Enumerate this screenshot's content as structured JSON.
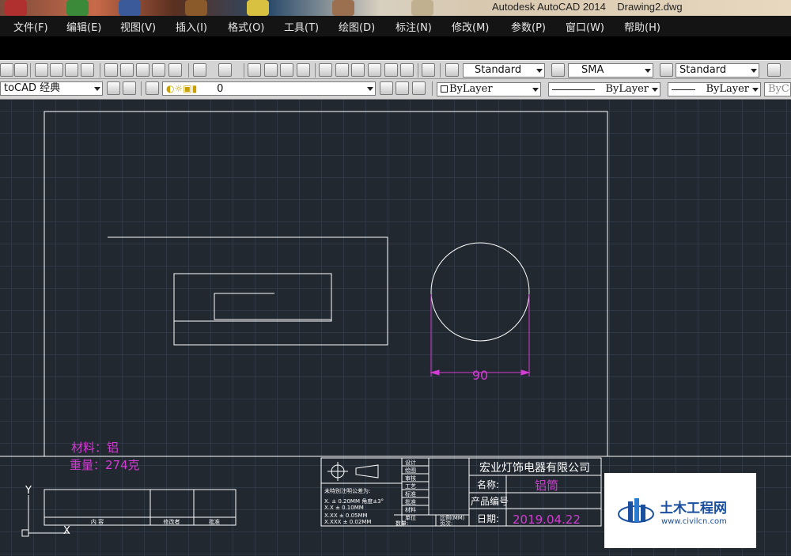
{
  "window": {
    "title": "Autodesk AutoCAD 2014    Drawing2.dwg"
  },
  "menu": {
    "items": [
      "文件(F)",
      "编辑(E)",
      "视图(V)",
      "插入(I)",
      "格式(O)",
      "工具(T)",
      "绘图(D)",
      "标注(N)",
      "修改(M)",
      "参数(P)",
      "窗口(W)",
      "帮助(H)"
    ]
  },
  "toolbar1": {
    "text_style": "Standard",
    "dim_style": "SMA",
    "table_style": "Standard"
  },
  "toolbar2": {
    "workspace": "toCAD 经典",
    "layer": "0",
    "color": "ByLayer",
    "linetype": "ByLayer",
    "lineweight": "ByLayer",
    "plotstyle": "ByCo"
  },
  "drawing": {
    "dimension_value": "90",
    "material_label": "材料：铝",
    "weight_label": "重量：274克",
    "ucs_x": "X",
    "ucs_y": "Y",
    "title_block": {
      "company": "宏业灯饰电器有限公司",
      "name_label": "名称:",
      "name_value": "铝筒",
      "product_no_label": "产品编号",
      "date_label": "日期:",
      "date_value": "2019.04.22",
      "role_labels": [
        "设计",
        "绘图",
        "审核",
        "工艺",
        "标准",
        "批准"
      ],
      "tolerance_title": "未特别注明公差为:",
      "tolerance_lines": [
        "X.       ± 0.20MM  角度±3°",
        "X.X      ± 0.10MM",
        "X.XX     ± 0.05MM",
        "X.XXX ± 0.02MM"
      ],
      "unit_label": "单位",
      "scale_label": "比例(MM)",
      "qty_label": "数量:",
      "page_label": "页次:",
      "material_cell": "材料"
    },
    "revision_block": {
      "col1": "内  容",
      "col2": "修改者",
      "col3": "批准"
    }
  },
  "watermark": {
    "name": "土木工程网",
    "url": "www.civilcn.com"
  },
  "colors": {
    "canvas_bg": "#212830",
    "white_line": "#ffffff",
    "magenta": "#d23cd2"
  }
}
